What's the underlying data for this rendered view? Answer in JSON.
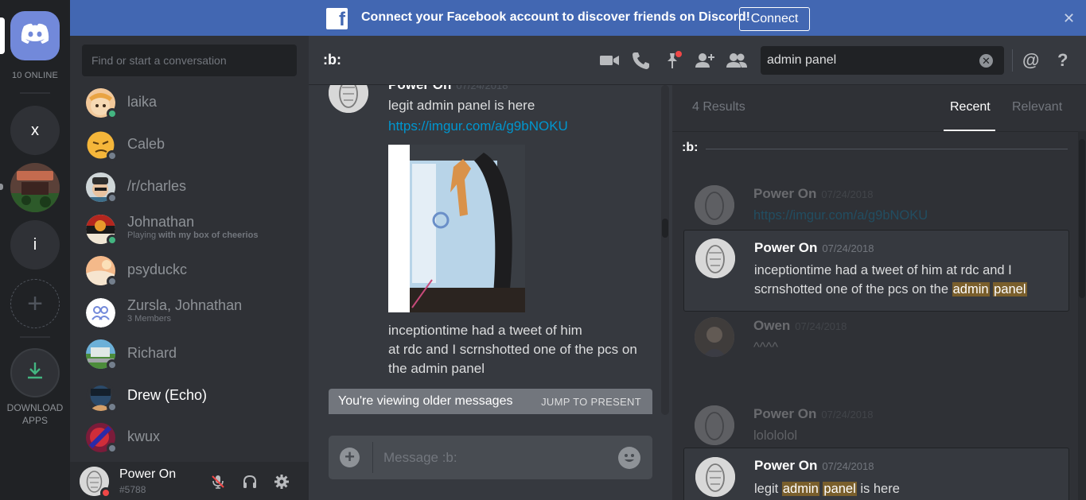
{
  "guilds": {
    "online_count": "10 ONLINE",
    "x_label": "x",
    "i_label": "i",
    "download_label": "DOWNLOAD APPS"
  },
  "banner": {
    "text": "Connect your Facebook account to discover friends on Discord!",
    "connect_label": "Connect",
    "close_label": "✕",
    "fb_letter": "f"
  },
  "dm": {
    "search_placeholder": "Find or start a conversation",
    "items": [
      {
        "name": "laika",
        "status": "online"
      },
      {
        "name": "Caleb",
        "status": "offline"
      },
      {
        "name": "/r/charles",
        "status": "offline"
      },
      {
        "name": "Johnathan",
        "sub_prefix": "Playing ",
        "sub_bold": "with my box of cheerios",
        "status": "online"
      },
      {
        "name": "psyduckc",
        "status": "offline"
      },
      {
        "name": "Zursla, Johnathan",
        "sub": "3 Members",
        "status": "none"
      },
      {
        "name": "Richard",
        "status": "offline"
      },
      {
        "name": "Drew (Echo)",
        "status": "offline"
      },
      {
        "name": "kwux",
        "status": "offline"
      }
    ]
  },
  "user": {
    "name": "Power On",
    "tag": "#5788"
  },
  "header": {
    "channel": ":b:",
    "search_value": "admin panel",
    "search_clear": "✕",
    "at_label": "@",
    "help_label": "?"
  },
  "chat": {
    "author": "Power On",
    "date": "07/24/2018",
    "line1": "legit admin panel is here",
    "link": "https://imgur.com/a/g9bNOKU",
    "body_lines": [
      "inceptiontime had a tweet of him",
      "at rdc and I scrnshotted one of the pcs on",
      "the admin panel"
    ],
    "older_text": "You're viewing older messages",
    "jump_label": "JUMP TO PRESENT",
    "composer_placeholder": "Message :b:",
    "composer_plus": "+"
  },
  "results": {
    "count": "4 Results",
    "tab_recent": "Recent",
    "tab_relevant": "Relevant",
    "channel": ":b:",
    "cards": [
      {
        "name": "Power On",
        "date": "07/24/2018",
        "text": "https://imgur.com/a/g9bNOKU"
      },
      {
        "name": "Power On",
        "date": "07/24/2018",
        "text_a": "inceptiontime had a tweet of him at rdc and I scrnshotted one of the pcs on the ",
        "hl1": "admin",
        "hl2": "panel"
      },
      {
        "name": "Owen",
        "date": "07/24/2018",
        "text": "^^^^"
      },
      {
        "name": "Power On",
        "date": "07/24/2018",
        "text": "lolololol"
      },
      {
        "name": "Power On",
        "date": "07/24/2018",
        "text_a": "legit ",
        "hl1": "admin",
        "hl2": "panel",
        "text_b": " is here"
      }
    ]
  },
  "colors": {
    "blurple": "#7289da",
    "facebook_blue": "#4267b2",
    "link": "#0096cf",
    "highlight": "#7a5f2c",
    "online": "#43b581",
    "dnd": "#f04747"
  }
}
